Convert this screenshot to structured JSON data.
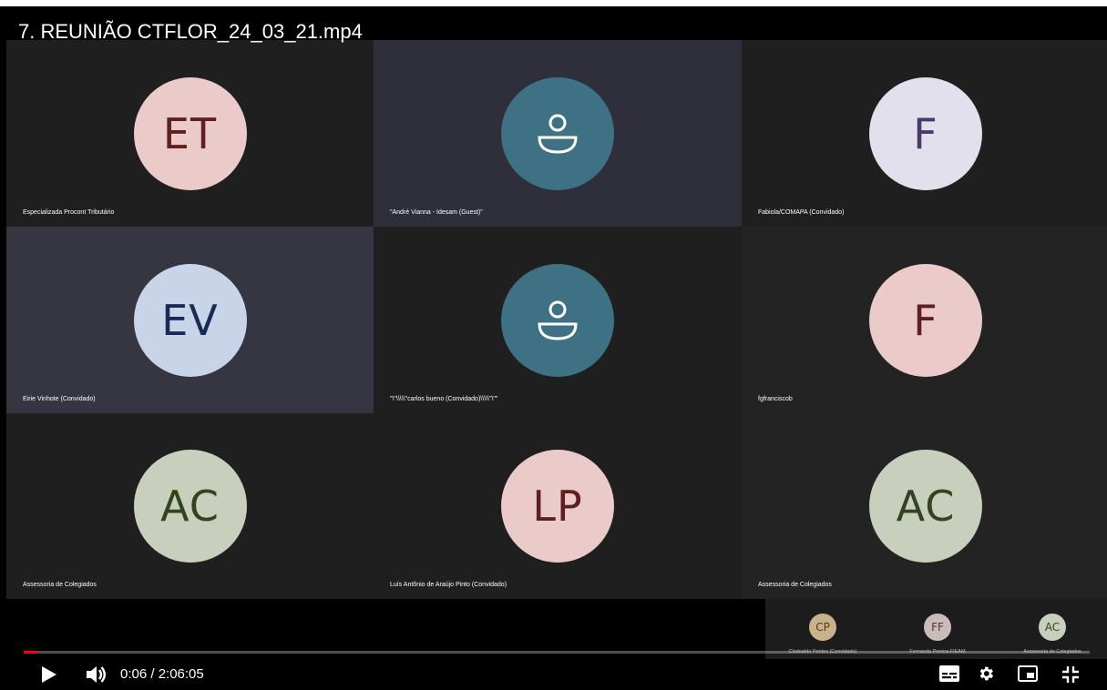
{
  "video": {
    "title": "7. REUNIÃO CTFLOR_24_03_21.mp4",
    "current_time": "0:06",
    "duration": "2:06:05",
    "time_display": "0:06 / 2:06:05",
    "progress": 0.0008
  },
  "participants": [
    {
      "label": "Especializada Procont Tributário",
      "initials": "ET",
      "avatar_bg": "#ebcaca",
      "avatar_fg": "#5d1f1f",
      "tile_bg": "#1f1f1f",
      "icon": null
    },
    {
      "label": "\"André Vianna - Idesam (Guest)\"",
      "initials": "",
      "avatar_bg": "#3f7185",
      "avatar_fg": "#ffffff",
      "tile_bg": "#2f2f3b",
      "icon": "person-icon"
    },
    {
      "label": "Fabiola/COMAPA (Convidado)",
      "initials": "F",
      "avatar_bg": "#e2e0ec",
      "avatar_fg": "#4a3a66",
      "tile_bg": "#1f1f1f",
      "icon": null
    },
    {
      "label": "Eirie Vinhote (Convidado)",
      "initials": "EV",
      "avatar_bg": "#c8d5e8",
      "avatar_fg": "#1a2a55",
      "tile_bg": "#353641",
      "icon": null
    },
    {
      "label": "\"\\\"\\\\\\\\\\\"carlos bueno (Convidado)\\\\\\\\\\\"\\\"\"",
      "initials": "",
      "avatar_bg": "#3f7185",
      "avatar_fg": "#ffffff",
      "tile_bg": "#1f1f1f",
      "icon": "person-icon"
    },
    {
      "label": "fgfranciscob",
      "initials": "F",
      "avatar_bg": "#ebcaca",
      "avatar_fg": "#5d1f1f",
      "tile_bg": "#232323",
      "icon": null
    },
    {
      "label": "Assessoria de Colegiados",
      "initials": "AC",
      "avatar_bg": "#c8cfbc",
      "avatar_fg": "#33421f",
      "tile_bg": "#1f1f1f",
      "icon": null
    },
    {
      "label": "Luís Antônio de Araújo Pinto (Convidado)",
      "initials": "LP",
      "avatar_bg": "#ebcaca",
      "avatar_fg": "#5d1f1f",
      "tile_bg": "#1f1f1f",
      "icon": null
    },
    {
      "label": "Assessoria de Colegiados",
      "initials": "AC",
      "avatar_bg": "#c8cfbc",
      "avatar_fg": "#33421f",
      "tile_bg": "#232323",
      "icon": null
    }
  ],
  "mini_participants": [
    {
      "label": "Clodoaldo Pontes (Convidado)",
      "initials": "CP",
      "avatar_bg": "#c9b28a",
      "avatar_fg": "#4a3a1a"
    },
    {
      "label": "Fernanda Pereira FIEAM",
      "initials": "FF",
      "avatar_bg": "#cbbcbc",
      "avatar_fg": "#4a3a3a"
    },
    {
      "label": "Assessoria de Colegiados",
      "initials": "AC",
      "avatar_bg": "#c8cfbc",
      "avatar_fg": "#33421f"
    }
  ],
  "controls": {
    "play": "play-icon",
    "volume": "volume-icon",
    "subtitles": "subtitles-icon",
    "settings": "gear-icon",
    "miniplayer": "miniplayer-icon",
    "exit_fullscreen": "exit-fullscreen-icon"
  },
  "colors": {
    "progress_played": "#ff0000",
    "progress_buffer": "#ff5a5a",
    "accent": "#3f7185"
  }
}
